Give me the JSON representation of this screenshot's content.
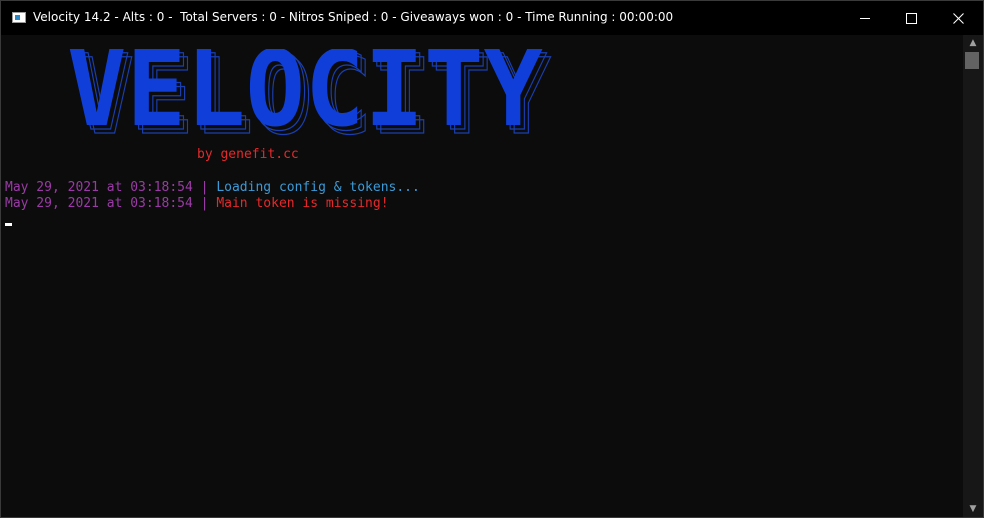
{
  "window": {
    "title": "Velocity 14.2 - Alts : 0 -  Total Servers : 0 - Nitros Sniped : 0 - Giveaways won : 0 - Time Running : 00:00:00"
  },
  "logo": {
    "text": "VELOCITY",
    "color": "#0f3fd8",
    "shadow_color": "#1a3fb0"
  },
  "byline": "by genefit.cc",
  "console_lines": [
    {
      "timestamp": "May 29, 2021 at 03:18:54",
      "separator": "|",
      "message": "Loading config & tokens..."
    },
    {
      "timestamp": "May 29, 2021 at 03:18:54",
      "separator": "|",
      "message": "Main token is missing!"
    }
  ],
  "colors": {
    "timestamp": "#9b3aa6",
    "info": "#3c9ad6",
    "error": "#e5292b",
    "background": "#0c0c0c"
  },
  "icons": {
    "app": "console-app-icon",
    "minimize": "minimize-icon",
    "maximize": "maximize-icon",
    "close": "close-icon",
    "scroll_up": "scroll-up-arrow-icon",
    "scroll_down": "scroll-down-arrow-icon"
  }
}
